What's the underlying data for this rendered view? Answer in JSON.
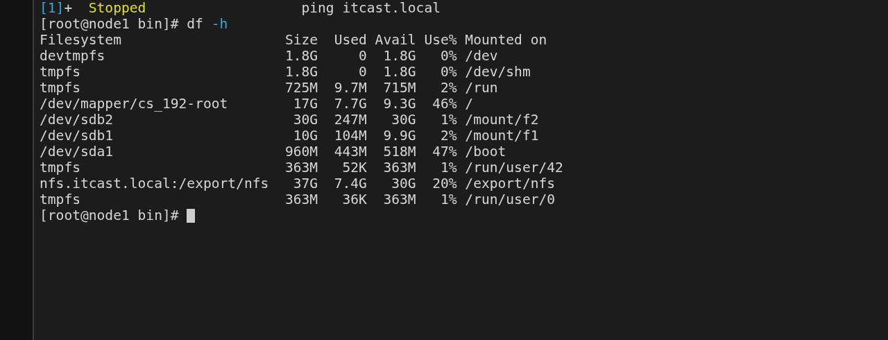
{
  "job_line": {
    "job_id": "[1]",
    "flag": "+",
    "status": "Stopped",
    "command": "ping itcast.local"
  },
  "command_line": {
    "prompt": "[root@node1 bin]#",
    "command": "df",
    "option": "-h"
  },
  "table": {
    "columns": [
      "Filesystem",
      "Size",
      "Used",
      "Avail",
      "Use%",
      "Mounted on"
    ],
    "rows": [
      [
        "devtmpfs",
        "1.8G",
        "0",
        "1.8G",
        "0%",
        "/dev"
      ],
      [
        "tmpfs",
        "1.8G",
        "0",
        "1.8G",
        "0%",
        "/dev/shm"
      ],
      [
        "tmpfs",
        "725M",
        "9.7M",
        "715M",
        "2%",
        "/run"
      ],
      [
        "/dev/mapper/cs_192-root",
        "17G",
        "7.7G",
        "9.3G",
        "46%",
        "/"
      ],
      [
        "/dev/sdb2",
        "30G",
        "247M",
        "30G",
        "1%",
        "/mount/f2"
      ],
      [
        "/dev/sdb1",
        "10G",
        "104M",
        "9.9G",
        "2%",
        "/mount/f1"
      ],
      [
        "/dev/sda1",
        "960M",
        "443M",
        "518M",
        "47%",
        "/boot"
      ],
      [
        "tmpfs",
        "363M",
        "52K",
        "363M",
        "1%",
        "/run/user/42"
      ],
      [
        "nfs.itcast.local:/export/nfs",
        "37G",
        "7.4G",
        "30G",
        "20%",
        "/export/nfs"
      ],
      [
        "tmpfs",
        "363M",
        "36K",
        "363M",
        "1%",
        "/run/user/0"
      ]
    ]
  },
  "final_prompt": {
    "prompt": "[root@node1 bin]#"
  }
}
